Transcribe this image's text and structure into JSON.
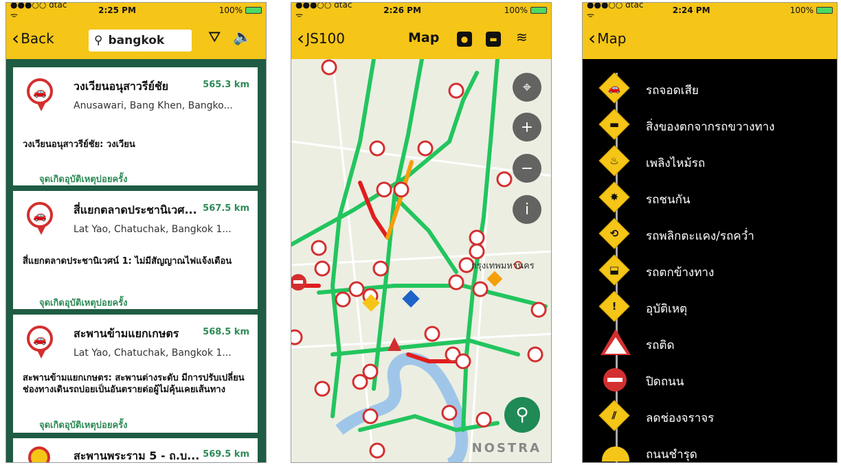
{
  "status": {
    "p1": {
      "carrier": "●●●○○ dtac ᯤ",
      "time": "2:25 PM",
      "battery": "100%"
    },
    "p2": {
      "carrier": "●●●○○ dtac ᯤ",
      "time": "2:26 PM",
      "battery": "100%"
    },
    "p3": {
      "carrier": "●●●○○ dtac ᯤ",
      "time": "2:24 PM",
      "battery": "100%"
    }
  },
  "list_screen": {
    "back_label": "Back",
    "search_value": "bangkok",
    "cards": [
      {
        "title": "วงเวียนอนุสาวรีย์ชัย",
        "distance": "565.3 km",
        "address": "Anusawari, Bang Khen, Bangko...",
        "desc": "วงเวียนอนุสาวรีย์ชัย: วงเวียน",
        "link": "จุดเกิดอุบัติเหตุบ่อยครั้ง"
      },
      {
        "title": "สี่แยกตลาดประชานิเวศ...",
        "distance": "567.5 km",
        "address": "Lat Yao, Chatuchak, Bangkok 1...",
        "desc": "สี่แยกตลาดประชานิเวศน์ 1: ไม่มีสัญญาณไฟแจ้งเตือน",
        "link": "จุดเกิดอุบัติเหตุบ่อยครั้ง"
      },
      {
        "title": "สะพานข้ามแยกเกษตร",
        "distance": "568.5 km",
        "address": "Lat Yao, Chatuchak, Bangkok 1...",
        "desc": "สะพานข้ามแยกเกษตร: สะพานต่างระดับ มีการปรับเปลี่ยนช่องทางเดินรถบ่อยเป็นอันตรายต่อผู้ไม่คุ้นเคยเส้นทาง",
        "link": "จุดเกิดอุบัติเหตุบ่อยครั้ง"
      },
      {
        "title": "สะพานพระราม 5 - ถ.บ...",
        "distance": "569.5 km"
      }
    ]
  },
  "map_screen": {
    "back_label": "JS100",
    "title": "Map",
    "watermark": "NOSTRA",
    "place_label": "กรุงเทพมหานคร"
  },
  "legend_screen": {
    "back_label": "Map",
    "items": [
      {
        "label": "รถจอดเสีย",
        "icon": "broken-car-icon"
      },
      {
        "label": "สิ่งของตกจากรถขวางทาง",
        "icon": "fallen-object-icon"
      },
      {
        "label": "เพลิงไหม้รถ",
        "icon": "car-fire-icon"
      },
      {
        "label": "รถชนกัน",
        "icon": "collision-icon"
      },
      {
        "label": "รถพลิกตะแคง/รถคว่ำ",
        "icon": "overturned-car-icon"
      },
      {
        "label": "รถตกข้างทาง",
        "icon": "off-road-car-icon"
      },
      {
        "label": "อุบัติเหตุ",
        "icon": "accident-icon"
      },
      {
        "label": "รถติด",
        "icon": "traffic-jam-icon"
      },
      {
        "label": "ปิดถนน",
        "icon": "road-closed-icon"
      },
      {
        "label": "ลดช่องจราจร",
        "icon": "lane-reduction-icon"
      },
      {
        "label": "ถนนชำรุด",
        "icon": "damaged-road-icon"
      }
    ]
  },
  "colors": {
    "header": "#f5c518",
    "list_bg": "#1f5c43",
    "traffic_green": "#22c55e",
    "traffic_red": "#e11d1d",
    "traffic_orange": "#f59e0b"
  }
}
